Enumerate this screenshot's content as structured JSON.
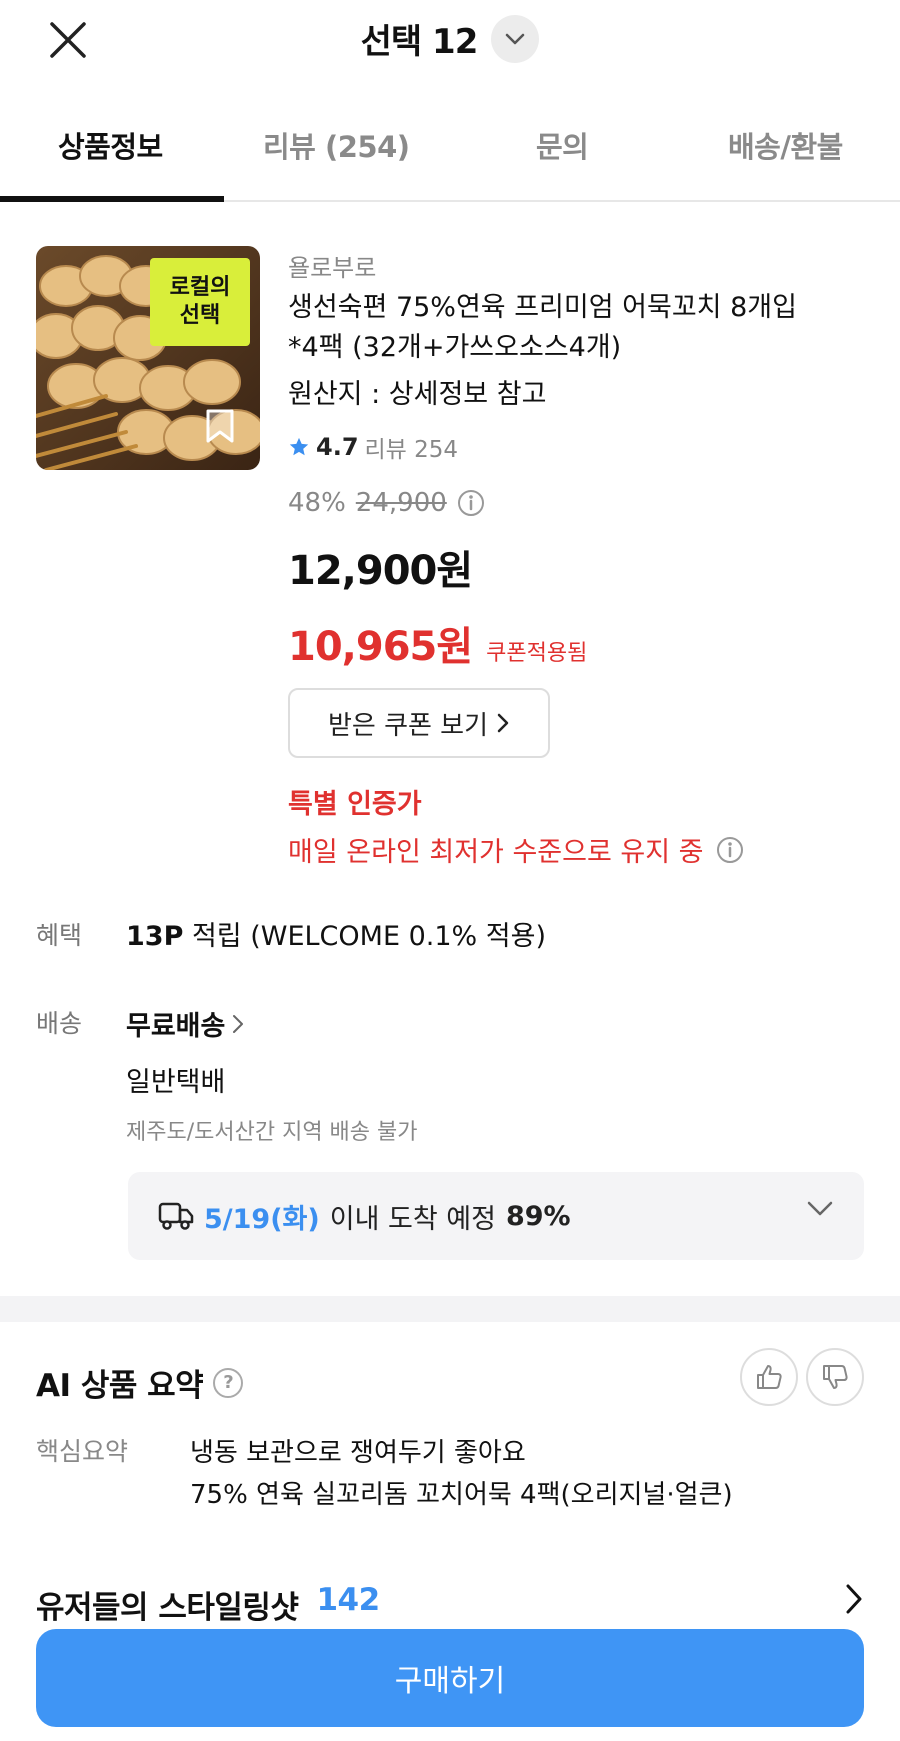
{
  "header": {
    "title": "선택 12"
  },
  "tabs": [
    {
      "label": "상품정보"
    },
    {
      "label": "리뷰 (254)"
    },
    {
      "label": "문의"
    },
    {
      "label": "배송/환불"
    }
  ],
  "product": {
    "thumbnail_badge_line1": "로컬의",
    "thumbnail_badge_line2": "선택",
    "brand": "욜로부로",
    "name_line1": "생선숙편 75%연육 프리미엄 어묵꼬치 8개입",
    "name_line2": "*4팩 (32개+가쓰오소스4개)",
    "origin": "원산지 : 상세정보 참고",
    "rating": "4.7",
    "review_text": "리뷰 254",
    "discount_pct": "48%",
    "original_price": "24,900",
    "price": "12,900원",
    "coupon_price": "10,965원",
    "coupon_applied": "쿠폰적용됨",
    "coupon_button": "받은 쿠폰 보기",
    "special_title": "특별 인증가",
    "special_desc": "매일 온라인 최저가 수준으로 유지 중"
  },
  "benefit": {
    "label": "혜택",
    "points": "13P",
    "rest": " 적립 (WELCOME 0.1% 적용)"
  },
  "shipping": {
    "label": "배송",
    "main": "무료배송",
    "type": "일반택배",
    "note": "제주도/도서산간 지역 배송 불가",
    "arrival_date": "5/19(화)",
    "arrival_text": "이내 도착 예정",
    "arrival_pct": "89%"
  },
  "ai_summary": {
    "title": "AI 상품 요약",
    "label": "핵심요약",
    "line1": "냉동 보관으로 쟁여두기 좋아요",
    "line2": "75% 연육 실꼬리돔 꼬치어묵 4팩(오리지널·얼큰)"
  },
  "styling": {
    "title": "유저들의 스타일링샷",
    "count": "142"
  },
  "buy_button": "구매하기",
  "colors": {
    "accent": "#3f95f5",
    "sale": "#e0312f",
    "badge": "#d9ee3a"
  }
}
